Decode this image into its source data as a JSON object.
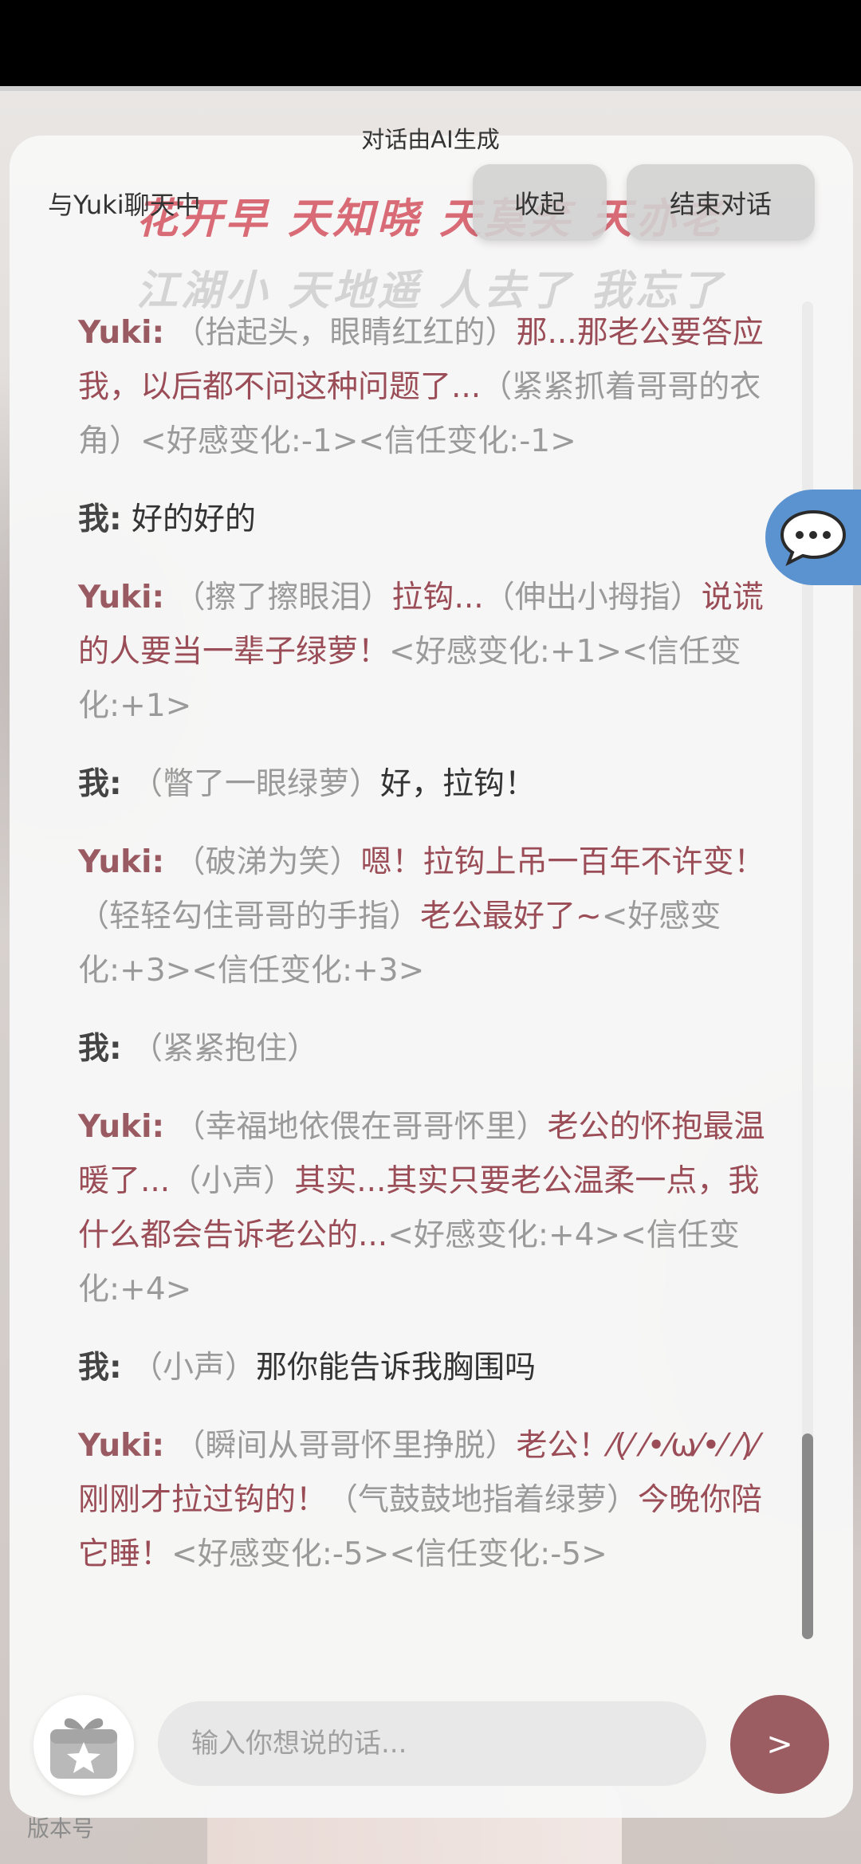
{
  "notice": "对话由AI生成",
  "header": {
    "title": "与Yuki聊天中",
    "collapse_label": "收起",
    "end_label": "结束对话"
  },
  "watermark": {
    "line1": "花开早 天知晓 天莫笑 天亦老",
    "line2": "江湖小 天地遥 人去了 我忘了"
  },
  "messages": [
    {
      "speaker": "Yuki:",
      "role": "yuki",
      "parts": [
        {
          "t": "action",
          "text": "（抬起头，眼睛红红的）"
        },
        {
          "t": "speech",
          "text": "那...那老公要答应我，以后都不问这种问题了..."
        },
        {
          "t": "action",
          "text": "（紧紧抓着哥哥的衣角）"
        },
        {
          "t": "stat",
          "text": "<好感变化:-1><信任变化:-1>"
        }
      ]
    },
    {
      "speaker": "我:",
      "role": "me",
      "parts": [
        {
          "t": "speech",
          "text": "好的好的"
        }
      ]
    },
    {
      "speaker": "Yuki:",
      "role": "yuki",
      "parts": [
        {
          "t": "action",
          "text": "（擦了擦眼泪）"
        },
        {
          "t": "speech",
          "text": "拉钩..."
        },
        {
          "t": "action",
          "text": "（伸出小拇指）"
        },
        {
          "t": "speech",
          "text": "说谎的人要当一辈子绿萝！"
        },
        {
          "t": "stat",
          "text": "<好感变化:+1><信任变化:+1>"
        }
      ]
    },
    {
      "speaker": "我:",
      "role": "me",
      "parts": [
        {
          "t": "action",
          "text": "（瞥了一眼绿萝）"
        },
        {
          "t": "speech",
          "text": "好，拉钩！"
        }
      ]
    },
    {
      "speaker": "Yuki:",
      "role": "yuki",
      "parts": [
        {
          "t": "action",
          "text": "（破涕为笑）"
        },
        {
          "t": "speech",
          "text": "嗯！拉钩上吊一百年不许变！"
        },
        {
          "t": "action",
          "text": "（轻轻勾住哥哥的手指）"
        },
        {
          "t": "speech",
          "text": "老公最好了~"
        },
        {
          "t": "stat",
          "text": "<好感变化:+3><信任变化:+3>"
        }
      ]
    },
    {
      "speaker": "我:",
      "role": "me",
      "parts": [
        {
          "t": "action",
          "text": "（紧紧抱住）"
        }
      ]
    },
    {
      "speaker": "Yuki:",
      "role": "yuki",
      "parts": [
        {
          "t": "action",
          "text": "（幸福地依偎在哥哥怀里）"
        },
        {
          "t": "speech",
          "text": "老公的怀抱最温暖了..."
        },
        {
          "t": "action",
          "text": "（小声）"
        },
        {
          "t": "speech",
          "text": "其实...其实只要老公温柔一点，我什么都会告诉老公的..."
        },
        {
          "t": "stat",
          "text": "<好感变化:+4><信任变化:+4>"
        }
      ]
    },
    {
      "speaker": "我:",
      "role": "me",
      "parts": [
        {
          "t": "action",
          "text": "（小声）"
        },
        {
          "t": "speech",
          "text": "那你能告诉我胸围吗"
        }
      ]
    },
    {
      "speaker": "Yuki:",
      "role": "yuki",
      "parts": [
        {
          "t": "action",
          "text": "（瞬间从哥哥怀里挣脱）"
        },
        {
          "t": "speech",
          "text": "老公！⁄(⁄ ⁄•⁄ω⁄•⁄ ⁄)⁄ 刚刚才拉过钩的！"
        },
        {
          "t": "action",
          "text": "（气鼓鼓地指着绿萝）"
        },
        {
          "t": "speech",
          "text": "今晚你陪它睡！"
        },
        {
          "t": "stat",
          "text": "<好感变化:-5><信任变化:-5>"
        }
      ]
    }
  ],
  "input": {
    "placeholder": "输入你想说的话..."
  },
  "send_label": ">",
  "version_label": "版本号",
  "icons": {
    "float": "chat-bubble-icon",
    "gift": "gift-star-icon"
  },
  "colors": {
    "accent": "#9c5d62",
    "float_button": "#5b93d0",
    "yuki_speech": "#9a4d57",
    "action_text": "#9a9a9a"
  }
}
